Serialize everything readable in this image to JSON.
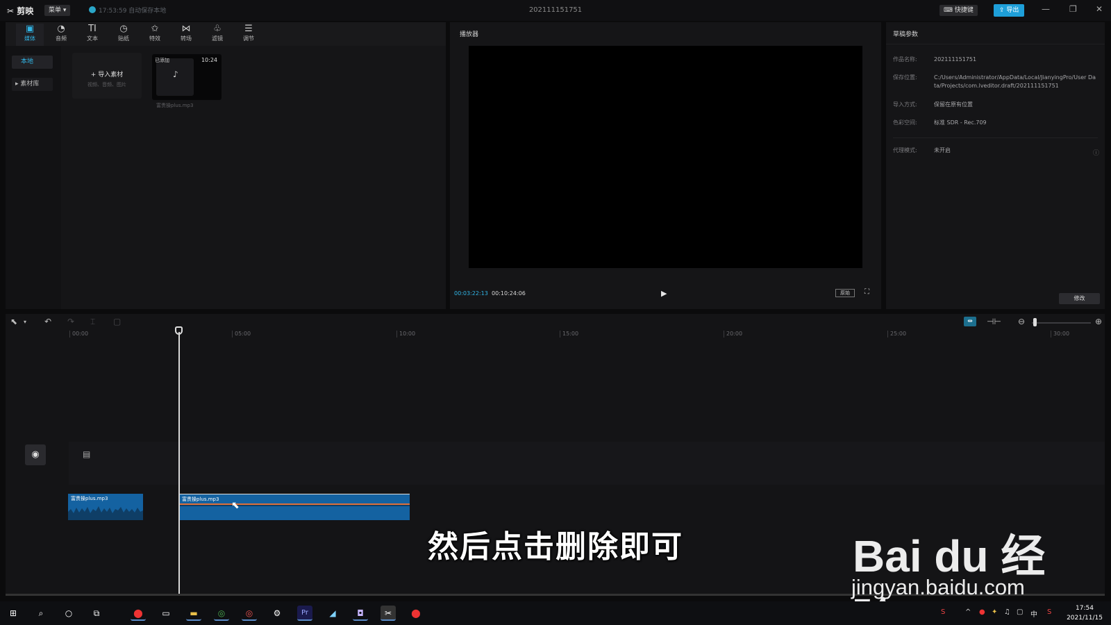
{
  "titlebar": {
    "app_name": "剪映",
    "menu_label": "菜单 ▾",
    "autosave_text": "17:53:59 自动保存本地",
    "project_title": "202111151751",
    "shortcut_label": "快捷键",
    "export_label": "导出",
    "window_controls": [
      "—",
      "❐",
      "✕"
    ]
  },
  "media": {
    "tabs": [
      {
        "label": "媒体",
        "icon": "media-icon",
        "glyph": "▣",
        "active": true
      },
      {
        "label": "音频",
        "icon": "audio-icon",
        "glyph": "◔"
      },
      {
        "label": "文本",
        "icon": "text-icon",
        "glyph": "TI"
      },
      {
        "label": "贴纸",
        "icon": "sticker-icon",
        "glyph": "◷"
      },
      {
        "label": "特效",
        "icon": "effects-icon",
        "glyph": "✩"
      },
      {
        "label": "转场",
        "icon": "transition-icon",
        "glyph": "⋈"
      },
      {
        "label": "滤镜",
        "icon": "filter-icon",
        "glyph": "♧"
      },
      {
        "label": "调节",
        "icon": "adjust-icon",
        "glyph": "☰"
      }
    ],
    "side_local": "本地",
    "side_library": "▸ 素材库",
    "import_label": "+  导入素材",
    "import_sub": "视频、音频、图片",
    "thumb": {
      "added_label": "已添加",
      "duration": "10:24",
      "file_name": "富贵操plus.mp3"
    }
  },
  "player": {
    "title": "播放器",
    "time_current": "00:03:22:13",
    "time_total": "00:10:24:06",
    "ratio_label": "原始"
  },
  "props": {
    "title": "草稿参数",
    "rows": [
      {
        "label": "作品名称:",
        "value": "202111151751"
      },
      {
        "label": "保存位置:",
        "value": "C:/Users/Administrator/AppData/Local/JianyingPro/User Data/Projects/com.lveditor.draft/202111151751"
      },
      {
        "label": "导入方式:",
        "value": "保留在原有位置"
      },
      {
        "label": "色彩空间:",
        "value": "标准 SDR - Rec.709"
      },
      {
        "label": "代理模式:",
        "value": "未开启"
      }
    ],
    "modify_label": "修改"
  },
  "timeline": {
    "ruler_ticks": [
      "00:00",
      "05:00",
      "10:00",
      "15:00",
      "20:00",
      "25:00",
      "30:00"
    ],
    "clips": [
      {
        "name": "富贵操plus.mp3"
      },
      {
        "name": "富贵操plus.mp3"
      }
    ]
  },
  "subtitle": "然后点击删除即可",
  "watermark": {
    "brand": "Bai du 经验",
    "url": "jingyan.baidu.com"
  },
  "taskbar": {
    "apps": [
      "start-icon",
      "search-icon",
      "cortana-icon",
      "taskview-icon",
      "record-icon",
      "explorer-icon",
      "folder-icon",
      "chrome-icon",
      "chrome-icon",
      "settings-icon",
      "premiere-icon",
      "app-icon",
      "app-icon",
      "jianying-icon",
      "record-icon"
    ],
    "premiere_label": "Pr",
    "ime_label": "中",
    "clock_time": "17:54",
    "clock_date": "2021/11/15"
  }
}
